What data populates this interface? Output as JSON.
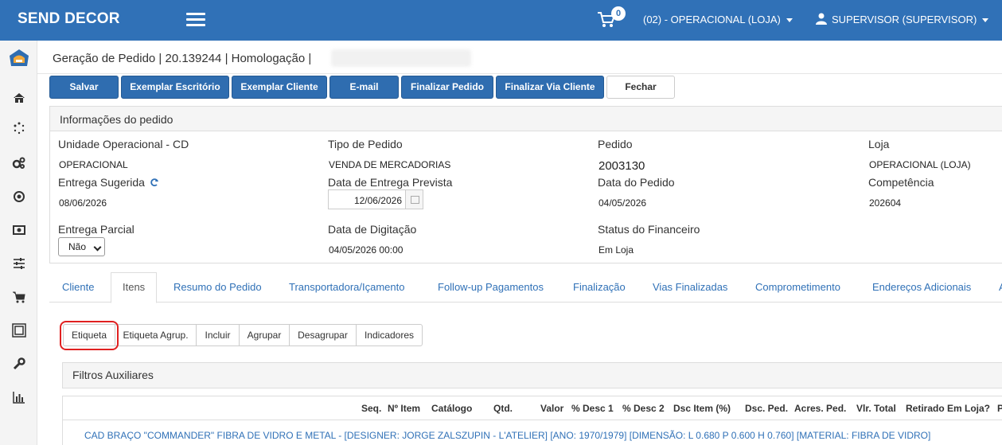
{
  "app": {
    "brand": "SEND DECOR",
    "cart_count": "0",
    "store_selector": "(02) - OPERACIONAL (LOJA)",
    "user": "SUPERVISOR (SUPERVISOR)"
  },
  "page": {
    "title": "Geração de Pedido | 20.139244 | Homologação |"
  },
  "toolbar": {
    "buttons": [
      "Salvar",
      "Exemplar Escritório",
      "Exemplar Cliente",
      "E-mail",
      "Finalizar Pedido",
      "Finalizar Via Cliente",
      "Fechar"
    ]
  },
  "info": {
    "header": "Informações do pedido",
    "unidade_label": "Unidade Operacional - CD",
    "unidade_value": "OPERACIONAL",
    "tipo_label": "Tipo de Pedido",
    "tipo_value": "VENDA DE MERCADORIAS",
    "pedido_label": "Pedido",
    "pedido_value": "2003130",
    "loja_label": "Loja",
    "loja_value": "OPERACIONAL (LOJA)",
    "entrega_sugerida_label": "Entrega Sugerida",
    "entrega_sugerida_value": "08/06/2026",
    "entrega_prevista_label": "Data de Entrega Prevista",
    "entrega_prevista_value": "12/06/2026",
    "data_pedido_label": "Data do Pedido",
    "data_pedido_value": "04/05/2026",
    "competencia_label": "Competência",
    "competencia_value": "202604",
    "entrega_parcial_label": "Entrega Parcial",
    "entrega_parcial_value": "Não",
    "digitacao_label": "Data de Digitação",
    "digitacao_value": "04/05/2026 00:00",
    "status_fin_label": "Status do Financeiro",
    "status_fin_value": "Em Loja"
  },
  "tabs": [
    "Cliente",
    "Itens",
    "Resumo do Pedido",
    "Transportadora/Içamento",
    "Follow-up Pagamentos",
    "Finalização",
    "Vias Finalizadas",
    "Comprometimento",
    "Endereços Adicionais",
    "A"
  ],
  "item_toolbar": [
    "Etiqueta",
    "Etiqueta Agrup.",
    "Incluir",
    "Agrupar",
    "Desagrupar",
    "Indicadores"
  ],
  "filters": {
    "title": "Filtros Auxiliares"
  },
  "table": {
    "columns": [
      "Seq.",
      "Nº Item",
      "Catálogo",
      "Qtd.",
      "Valor",
      "% Desc 1",
      "% Desc 2",
      "Dsc Item (%)",
      "Dsc. Ped.",
      "Acres. Ped.",
      "Vlr. Total",
      "Retirado Em Loja?",
      "P"
    ],
    "row_description": "CAD BRAÇO \"COMMANDER\" FIBRA DE VIDRO E METAL - [DESIGNER: JORGE ZALSZUPIN - L'ATELIER] [ANO: 1970/1979] [DIMENSÃO: L 0.680 P 0.600 H 0.760] [MATERIAL: FIBRA DE VIDRO]"
  },
  "colors": {
    "primary": "#3071b7",
    "button": "#2f6db0",
    "highlight": "#e02020"
  }
}
